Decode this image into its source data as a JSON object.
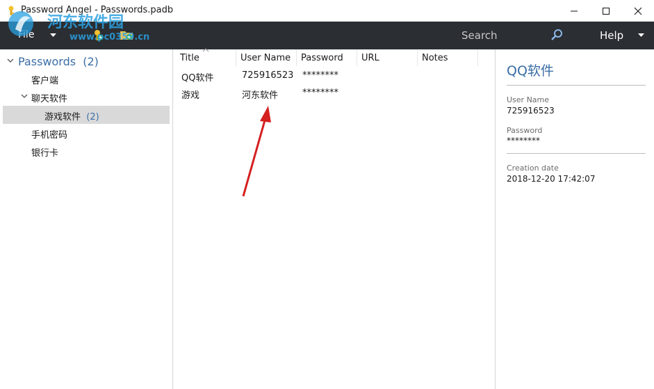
{
  "window": {
    "title": "Password Angel - Passwords.padb"
  },
  "toolbar": {
    "file_label": "File",
    "search_label": "Search",
    "help_label": "Help"
  },
  "watermark": {
    "line1": "河东软件园",
    "line2": "www.pc0359.cn"
  },
  "sidebar": {
    "root": {
      "label": "Passwords",
      "count": "(2)"
    },
    "items": [
      {
        "label": "客户端"
      },
      {
        "label": "聊天软件"
      },
      {
        "label": "游戏软件",
        "count": "(2)"
      },
      {
        "label": "手机密码"
      },
      {
        "label": "银行卡"
      }
    ]
  },
  "table": {
    "columns": [
      "Title",
      "User Name",
      "Password",
      "URL",
      "Notes"
    ],
    "rows": [
      {
        "title": "QQ软件",
        "username": "725916523",
        "password": "********",
        "url": "",
        "notes": ""
      },
      {
        "title": "游戏",
        "username": "河东软件",
        "password": "********",
        "url": "",
        "notes": ""
      }
    ]
  },
  "detail": {
    "title": "QQ软件",
    "username_label": "User Name",
    "username": "725916523",
    "password_label": "Password",
    "password": "********",
    "created_label": "Creation date",
    "created": "2018-12-20 17:42:07"
  },
  "colors": {
    "toolbar_bg": "#2b2e33",
    "accent": "#3a6ea5",
    "selected_row": "#d9d9d9",
    "arrow": "#d42020"
  }
}
